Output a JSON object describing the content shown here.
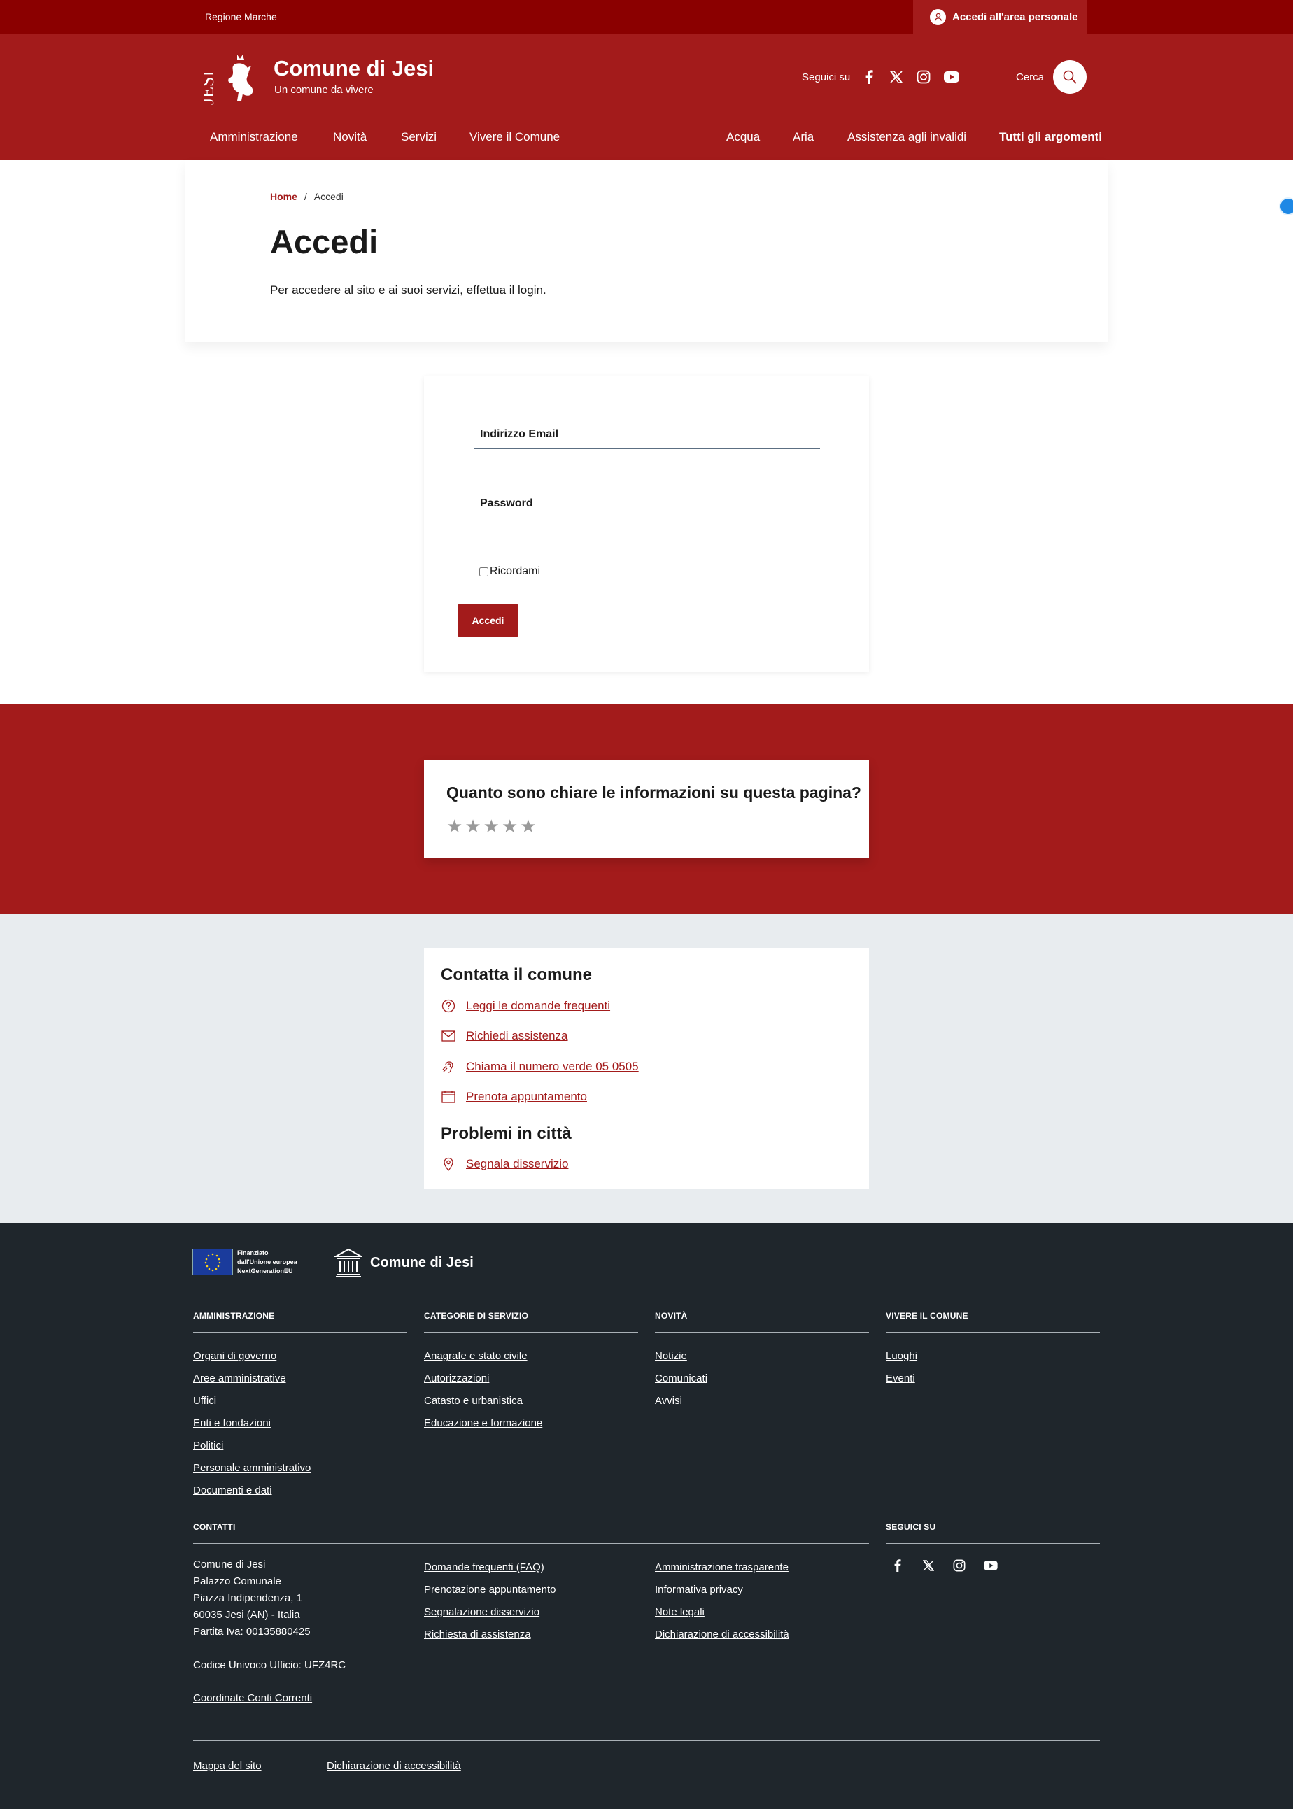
{
  "topbar": {
    "region": "Regione Marche",
    "login_label": "Accedi all'area personale"
  },
  "header": {
    "site_title": "Comune di Jesi",
    "site_tagline": "Un comune da vivere",
    "logo_text": "JESI",
    "social_label": "Seguici su",
    "social_icons": [
      "facebook-icon",
      "x-icon",
      "instagram-icon",
      "youtube-icon"
    ],
    "search_label": "Cerca",
    "nav_main": [
      "Amministrazione",
      "Novità",
      "Servizi",
      "Vivere il Comune"
    ],
    "nav_topics": [
      "Acqua",
      "Aria",
      "Assistenza agli invalidi",
      "Tutti gli argomenti"
    ]
  },
  "breadcrumb": {
    "home": "Home",
    "separator": "/",
    "current": "Accedi"
  },
  "intro": {
    "title": "Accedi",
    "description": "Per accedere al sito e ai suoi servizi, effettua il login."
  },
  "login_form": {
    "email_label": "Indirizzo Email",
    "password_label": "Password",
    "remember_label": "Ricordami",
    "submit_label": "Accedi"
  },
  "rating": {
    "question": "Quanto sono chiare le informazioni su questa pagina?",
    "stars": "★★★★★"
  },
  "contacts": {
    "title": "Contatta il comune",
    "links": [
      {
        "icon": "help-circle-icon",
        "label": "Leggi le domande frequenti"
      },
      {
        "icon": "mail-icon",
        "label": "Richiedi assistenza"
      },
      {
        "icon": "hearing-icon",
        "label": "Chiama il numero verde 05 0505"
      },
      {
        "icon": "calendar-icon",
        "label": "Prenota appuntamento"
      }
    ],
    "problems_title": "Problemi in città",
    "problem_link": {
      "icon": "map-marker-icon",
      "label": "Segnala disservizio"
    }
  },
  "footer": {
    "eu_text": "Finanziato\ndall'Unione europea\nNextGenerationEU",
    "name": "Comune di Jesi",
    "columns": [
      {
        "heading": "AMMINISTRAZIONE",
        "links": [
          "Organi di governo",
          "Aree amministrative",
          "Uffici",
          "Enti e fondazioni",
          "Politici",
          "Personale amministrativo",
          "Documenti e dati"
        ]
      },
      {
        "heading": "CATEGORIE DI SERVIZIO",
        "links": [
          "Anagrafe e stato civile",
          "Autorizzazioni",
          "Catasto e urbanistica",
          "Educazione e formazione"
        ]
      },
      {
        "heading": "NOVITÀ",
        "links": [
          "Notizie",
          "Comunicati",
          "Avvisi"
        ]
      },
      {
        "heading": "VIVERE IL COMUNE",
        "links": [
          "Luoghi",
          "Eventi"
        ]
      }
    ],
    "contacts_heading": "CONTATTI",
    "address_lines": [
      "Comune di Jesi",
      "Palazzo Comunale",
      "Piazza Indipendenza, 1",
      "60035 Jesi (AN) - Italia",
      "Partita Iva: 00135880425"
    ],
    "office_code": "Codice Univoco Ufficio: UFZ4RC",
    "accounts_link": "Coordinate Conti Correnti",
    "links_mid": [
      "Domande frequenti (FAQ)",
      "Prenotazione appuntamento",
      "Segnalazione disservizio",
      "Richiesta di assistenza"
    ],
    "links_right": [
      "Amministrazione trasparente",
      "Informativa privacy",
      "Note legali",
      "Dichiarazione di accessibilità"
    ],
    "follow_heading": "SEGUICI SU",
    "bottom_links": [
      "Mappa del sito",
      "Dichiarazione di accessibilità"
    ]
  },
  "colors": {
    "primary": "#a31b1b",
    "topbar": "#8b0000",
    "footer_bg": "#1f262c",
    "contact_bg": "#e8ecef"
  }
}
